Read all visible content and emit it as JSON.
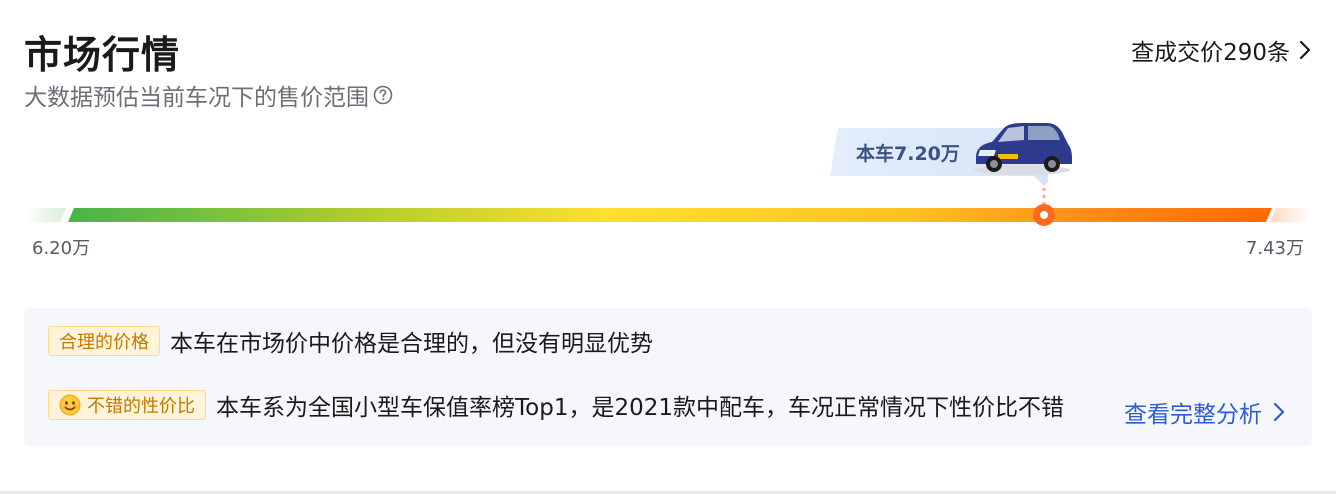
{
  "header": {
    "title": "市场行情",
    "subtitle": "大数据预估当前车况下的售价范围",
    "deals_link": "查成交价290条"
  },
  "price_range": {
    "current_label": "本车7.20万",
    "min_label": "6.20万",
    "max_label": "7.43万",
    "min": 6.2,
    "max": 7.43,
    "current": 7.2
  },
  "analysis": {
    "price_tag": "合理的价格",
    "price_text": "本车在市场价中价格是合理的，但没有明显优势",
    "value_tag": "不错的性价比",
    "value_text": "本车系为全国小型车保值率榜Top1，是2021款中配车，车况正常情况下性价比不错",
    "full_link": "查看完整分析"
  },
  "colors": {
    "accent_orange": "#ff6a1f",
    "link_blue": "#2f5bd3",
    "callout_text": "#3b5384",
    "tag_text": "#c17a00"
  },
  "icons": {
    "help": "question-circle-icon",
    "chevron": "chevron-right-icon",
    "smile": "smile-emoji-icon",
    "car": "car-image"
  }
}
